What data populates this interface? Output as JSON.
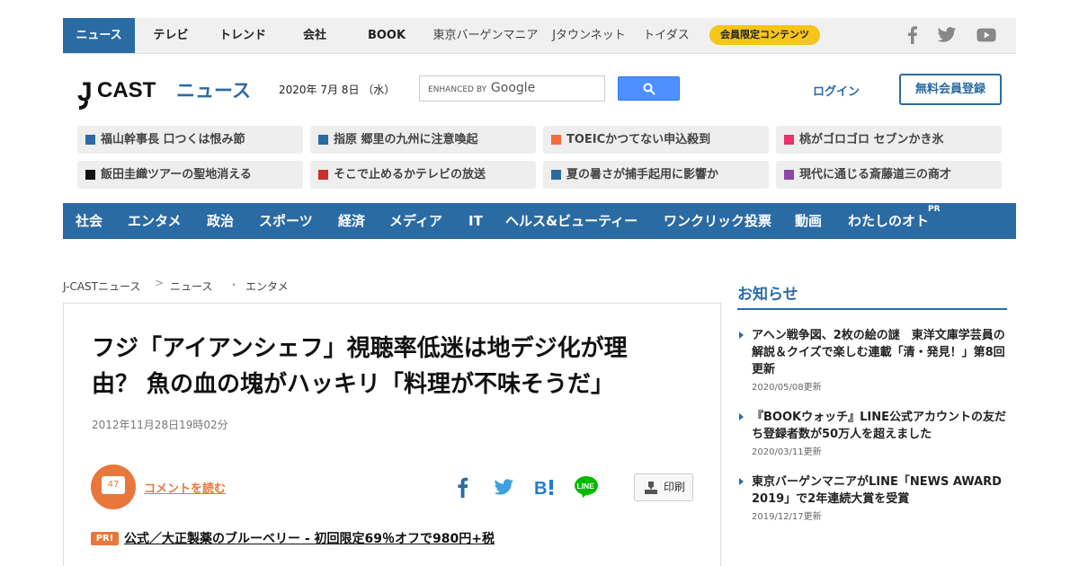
{
  "topnav": {
    "items": [
      "ニュース",
      "テレビ",
      "トレンド",
      "会社",
      "BOOK"
    ],
    "subitems": [
      "東京バーゲンマニア",
      "Jタウンネット",
      "トイダス"
    ],
    "member_label": "会員限定コンテンツ"
  },
  "header": {
    "logo_j": "J",
    "logo_cast": "CAST",
    "logo_news": "ニュース",
    "date": "2020年 7月 8日 （水）",
    "search_enhanced": "ENHANCED BY",
    "search_google": "Google",
    "login": "ログイン",
    "register": "無料会員登録"
  },
  "topics": [
    {
      "label": "福山幹事長 口つくは恨み節",
      "color": "#2b6ba3"
    },
    {
      "label": "指原 郷里の九州に注意喚起",
      "color": "#2b6ba3"
    },
    {
      "label": "TOEICかつてない申込殺到",
      "color": "#f26b3a"
    },
    {
      "label": "桃がゴロゴロ セブンかき氷",
      "color": "#e8336d"
    },
    {
      "label": "飯田圭織ツアーの聖地消える",
      "color": "#111111"
    },
    {
      "label": "そこで止めるかテレビの放送",
      "color": "#c9302c"
    },
    {
      "label": "夏の暑さが捕手起用に影響か",
      "color": "#2b6ba3"
    },
    {
      "label": "現代に通じる斎藤道三の商才",
      "color": "#8e44ad"
    }
  ],
  "categories": [
    "社会",
    "エンタメ",
    "政治",
    "スポーツ",
    "経済",
    "メディア",
    "IT",
    "ヘルス&ビューティー",
    "ワンクリック投票",
    "動画",
    "わたしのオト"
  ],
  "category_pr": "PR",
  "breadcrumb": [
    "J-CASTニュース",
    "ニュース",
    "エンタメ"
  ],
  "breadcrumb_seps": [
    ">",
    "・"
  ],
  "article": {
    "title_line1": "フジ「アイアンシェフ」視聴率低迷は地デジ化が理",
    "title_line2": "由？ 魚の血の塊がハッキリ「料理が不味そうだ」",
    "timestamp": "2012年11月28日19時02分",
    "comment_count": "47",
    "comment_link": "コメントを読む",
    "print_label": "印刷",
    "pr_badge": "PR!",
    "pr_link": "公式／大正製薬のブルーベリー - 初回限定69％オフで980円+税"
  },
  "sidebar": {
    "title": "お知らせ",
    "news": [
      {
        "text": "アヘン戦争図、2枚の絵の謎　東洋文庫学芸員の解説＆クイズで楽しむ連載「清・発見！」第8回更新",
        "date": "2020/05/08更新"
      },
      {
        "text": "『BOOKウォッチ』LINE公式アカウントの友だち登録者数が50万人を超えました",
        "date": "2020/03/11更新"
      },
      {
        "text": "東京バーゲンマニアがLINE「NEWS AWARD 2019」で2年連続大賞を受賞",
        "date": "2019/12/17更新"
      }
    ]
  },
  "colors": {
    "brand_blue": "#2b6ba3",
    "accent_orange": "#e8773b",
    "member_yellow": "#f5c518"
  }
}
